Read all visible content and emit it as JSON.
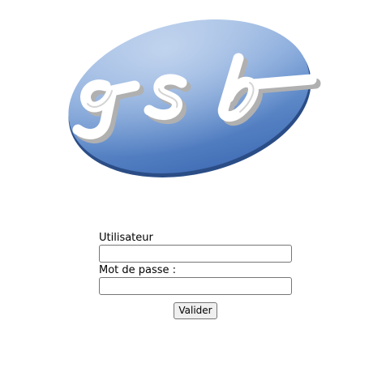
{
  "logo": {
    "text": "gsb",
    "colors": {
      "ellipse_light": "#9db9e2",
      "ellipse_mid": "#6b93cf",
      "ellipse_dark": "#3f69b0",
      "ellipse_shadow": "#2b4d86",
      "letters": "#ffffff",
      "letter_shadow": "#b8b8b8"
    }
  },
  "form": {
    "username_label": "Utilisateur",
    "username_value": "",
    "password_label": "Mot de passe :",
    "password_value": "",
    "submit_label": "Valider"
  }
}
